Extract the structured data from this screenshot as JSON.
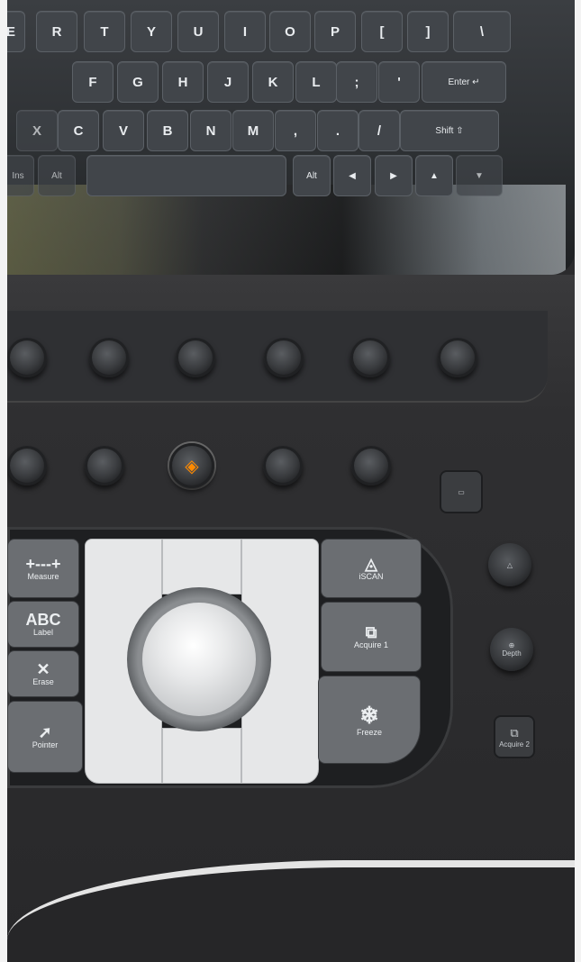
{
  "keyboard": {
    "row1": [
      "E",
      "R",
      "T",
      "Y",
      "U",
      "I",
      "O",
      "P",
      "[",
      "]",
      "\\"
    ],
    "row2": [
      "F",
      "G",
      "H",
      "J",
      "K",
      "L",
      ";",
      "'",
      "Enter ↵"
    ],
    "row3": [
      "X",
      "C",
      "V",
      "B",
      "N",
      "M",
      ",",
      ".",
      "/",
      "Shift ⇧"
    ],
    "row4": [
      "Ins",
      "Alt",
      "Alt",
      "◀",
      "▶",
      "▲",
      "▼"
    ]
  },
  "controls": {
    "measure_label": "Measure",
    "label_label": "Label",
    "label_icon_text": "ABC",
    "erase_label": "Erase",
    "pointer_label": "Pointer",
    "iscan_label": "iSCAN",
    "acquire1_label": "Acquire 1",
    "freeze_label": "Freeze",
    "depth_label": "Depth",
    "acquire2_label": "Acquire 2"
  },
  "colors": {
    "accent": "#ff8a00",
    "console": "#2b2b2d"
  }
}
